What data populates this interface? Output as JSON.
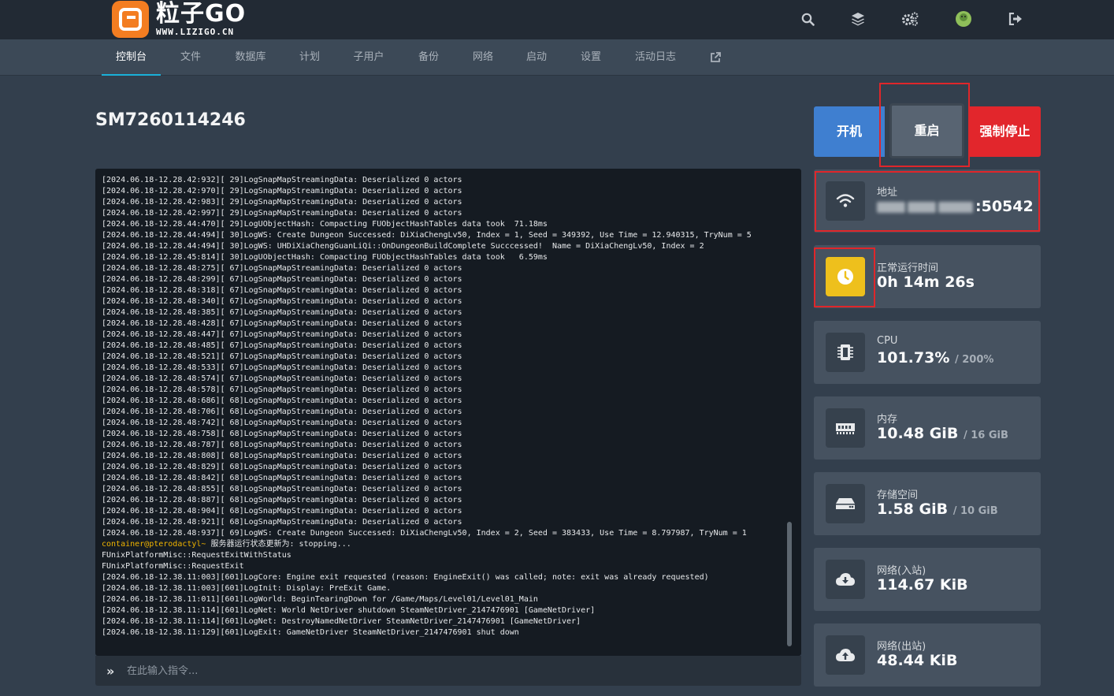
{
  "brand": {
    "name_cn": "粒子GO",
    "url": "WWW.LIZIGO.CN"
  },
  "top_icons": [
    "search-icon",
    "layers-icon",
    "cogs-icon",
    "avatar",
    "logout-icon"
  ],
  "nav": [
    {
      "label": "控制台",
      "active": true
    },
    {
      "label": "文件"
    },
    {
      "label": "数据库"
    },
    {
      "label": "计划"
    },
    {
      "label": "子用户"
    },
    {
      "label": "备份"
    },
    {
      "label": "网络"
    },
    {
      "label": "启动"
    },
    {
      "label": "设置"
    },
    {
      "label": "活动日志"
    },
    {
      "label": "",
      "icon": "external-link-icon"
    }
  ],
  "server": {
    "name": "SM7260114246"
  },
  "console": {
    "lines": [
      "[2024.06.18-12.28.42:932][ 29]LogSnapMapStreamingData: Deserialized 0 actors",
      "[2024.06.18-12.28.42:970][ 29]LogSnapMapStreamingData: Deserialized 0 actors",
      "[2024.06.18-12.28.42:983][ 29]LogSnapMapStreamingData: Deserialized 0 actors",
      "[2024.06.18-12.28.42:997][ 29]LogSnapMapStreamingData: Deserialized 0 actors",
      "[2024.06.18-12.28.44:470][ 29]LogUObjectHash: Compacting FUObjectHashTables data took  71.18ms",
      "[2024.06.18-12.28.44:494][ 30]LogWS: Create Dungeon Successed: DiXiaChengLv50, Index = 1, Seed = 349392, Use Time = 12.940315, TryNum = 5",
      "[2024.06.18-12.28.44:494][ 30]LogWS: UHDiXiaChengGuanLiQi::OnDungeonBuildComplete Succcessed!  Name = DiXiaChengLv50, Index = 2",
      "[2024.06.18-12.28.45:814][ 30]LogUObjectHash: Compacting FUObjectHashTables data took   6.59ms",
      "[2024.06.18-12.28.48:275][ 67]LogSnapMapStreamingData: Deserialized 0 actors",
      "[2024.06.18-12.28.48:299][ 67]LogSnapMapStreamingData: Deserialized 0 actors",
      "[2024.06.18-12.28.48:318][ 67]LogSnapMapStreamingData: Deserialized 0 actors",
      "[2024.06.18-12.28.48:340][ 67]LogSnapMapStreamingData: Deserialized 0 actors",
      "[2024.06.18-12.28.48:385][ 67]LogSnapMapStreamingData: Deserialized 0 actors",
      "[2024.06.18-12.28.48:428][ 67]LogSnapMapStreamingData: Deserialized 0 actors",
      "[2024.06.18-12.28.48:447][ 67]LogSnapMapStreamingData: Deserialized 0 actors",
      "[2024.06.18-12.28.48:485][ 67]LogSnapMapStreamingData: Deserialized 0 actors",
      "[2024.06.18-12.28.48:521][ 67]LogSnapMapStreamingData: Deserialized 0 actors",
      "[2024.06.18-12.28.48:533][ 67]LogSnapMapStreamingData: Deserialized 0 actors",
      "[2024.06.18-12.28.48:574][ 67]LogSnapMapStreamingData: Deserialized 0 actors",
      "[2024.06.18-12.28.48:578][ 67]LogSnapMapStreamingData: Deserialized 0 actors",
      "[2024.06.18-12.28.48:686][ 68]LogSnapMapStreamingData: Deserialized 0 actors",
      "[2024.06.18-12.28.48:706][ 68]LogSnapMapStreamingData: Deserialized 0 actors",
      "[2024.06.18-12.28.48:742][ 68]LogSnapMapStreamingData: Deserialized 0 actors",
      "[2024.06.18-12.28.48:758][ 68]LogSnapMapStreamingData: Deserialized 0 actors",
      "[2024.06.18-12.28.48:787][ 68]LogSnapMapStreamingData: Deserialized 0 actors",
      "[2024.06.18-12.28.48:808][ 68]LogSnapMapStreamingData: Deserialized 0 actors",
      "[2024.06.18-12.28.48:829][ 68]LogSnapMapStreamingData: Deserialized 0 actors",
      "[2024.06.18-12.28.48:842][ 68]LogSnapMapStreamingData: Deserialized 0 actors",
      "[2024.06.18-12.28.48:855][ 68]LogSnapMapStreamingData: Deserialized 0 actors",
      "[2024.06.18-12.28.48:887][ 68]LogSnapMapStreamingData: Deserialized 0 actors",
      "[2024.06.18-12.28.48:904][ 68]LogSnapMapStreamingData: Deserialized 0 actors",
      "[2024.06.18-12.28.48:921][ 68]LogSnapMapStreamingData: Deserialized 0 actors",
      "[2024.06.18-12.28.48:937][ 69]LogWS: Create Dungeon Successed: DiXiaChengLv50, Index = 2, Seed = 383433, Use Time = 8.797987, TryNum = 1",
      {
        "prompt": "container@pterodactyl~",
        "text": " 服务器运行状态更新为: stopping..."
      },
      "FUnixPlatformMisc::RequestExitWithStatus",
      "FUnixPlatformMisc::RequestExit",
      "[2024.06.18-12.38.11:003][601]LogCore: Engine exit requested (reason: EngineExit() was called; note: exit was already requested)",
      "[2024.06.18-12.38.11:003][601]LogInit: Display: PreExit Game.",
      "[2024.06.18-12.38.11:011][601]LogWorld: BeginTearingDown for /Game/Maps/Level01/Level01_Main",
      "[2024.06.18-12.38.11:114][601]LogNet: World NetDriver shutdown SteamNetDriver_2147476901 [GameNetDriver]",
      "[2024.06.18-12.38.11:114][601]LogNet: DestroyNamedNetDriver SteamNetDriver_2147476901 [GameNetDriver]",
      "[2024.06.18-12.38.11:129][601]LogExit: GameNetDriver SteamNetDriver_2147476901 shut down"
    ],
    "command_placeholder": "在此输入指令..."
  },
  "power": {
    "start": "开机",
    "restart": "重启",
    "kill": "强制停止"
  },
  "stats": {
    "address": {
      "label": "地址",
      "value": ":50542",
      "icon": "wifi-icon"
    },
    "uptime": {
      "label": "正常运行时间",
      "value": "0h 14m 26s",
      "icon": "clock-icon"
    },
    "cpu": {
      "label": "CPU",
      "value": "101.73%",
      "limit": "/ 200%",
      "icon": "cpu-icon"
    },
    "memory": {
      "label": "内存",
      "value": "10.48 GiB",
      "limit": "/ 16 GiB",
      "icon": "memory-icon"
    },
    "disk": {
      "label": "存储空间",
      "value": "1.58 GiB",
      "limit": "/ 10 GiB",
      "icon": "hdd-icon"
    },
    "net_in": {
      "label": "网络(入站)",
      "value": "114.67 KiB",
      "icon": "cloud-download-icon"
    },
    "net_out": {
      "label": "网络(出站)",
      "value": "48.44 KiB",
      "icon": "cloud-upload-icon"
    }
  },
  "colors": {
    "accent": "#1ab0d8",
    "start": "#3f7fd0",
    "kill": "#e2262c",
    "uptime_icon": "#eec01c",
    "highlight_box": "#e0262a"
  }
}
